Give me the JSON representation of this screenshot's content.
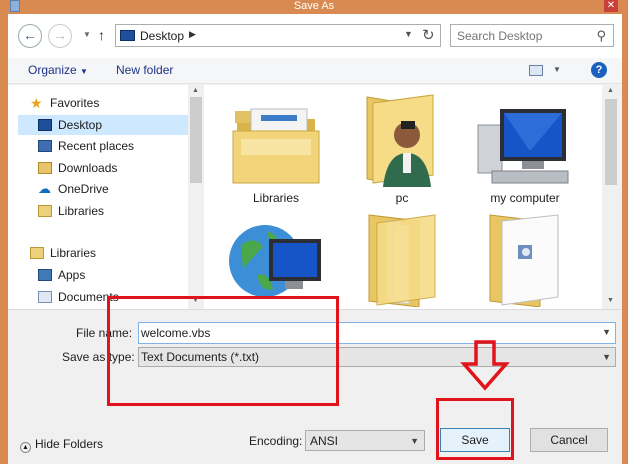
{
  "window": {
    "title": "Save As"
  },
  "address": {
    "location": "Desktop"
  },
  "search": {
    "placeholder": "Search Desktop"
  },
  "toolbar": {
    "organize_label": "Organize",
    "new_folder_label": "New folder"
  },
  "nav": {
    "items": [
      {
        "label": "Favorites",
        "icon": "star-icon"
      },
      {
        "label": "Desktop",
        "icon": "desktop-icon",
        "selected": true
      },
      {
        "label": "Recent places",
        "icon": "recent-places-icon"
      },
      {
        "label": "Downloads",
        "icon": "downloads-icon"
      },
      {
        "label": "OneDrive",
        "icon": "onedrive-icon"
      },
      {
        "label": "Libraries",
        "icon": "libraries-icon"
      },
      {
        "label": "Libraries",
        "icon": "libraries-icon"
      },
      {
        "label": "Apps",
        "icon": "apps-icon"
      },
      {
        "label": "Documents",
        "icon": "documents-icon"
      }
    ]
  },
  "content": {
    "items": [
      {
        "label": "Libraries",
        "icon": "libraries-folder-icon"
      },
      {
        "label": "pc",
        "icon": "user-folder-icon"
      },
      {
        "label": "my computer",
        "icon": "computer-icon"
      },
      {
        "label": "",
        "icon": "network-icon"
      },
      {
        "label": "",
        "icon": "folder-icon"
      },
      {
        "label": "",
        "icon": "file-folder-icon"
      }
    ]
  },
  "form": {
    "file_name_label": "File name:",
    "file_name_value": "welcome.vbs",
    "save_type_label": "Save as type:",
    "save_type_value": "Text Documents (*.txt)",
    "hide_folders_label": "Hide Folders",
    "encoding_label": "Encoding:",
    "encoding_value": "ANSI",
    "save_label": "Save",
    "cancel_label": "Cancel"
  },
  "colors": {
    "annotation": "#e2141b",
    "title_bar": "#d98a50",
    "selection": "#cde8ff"
  }
}
